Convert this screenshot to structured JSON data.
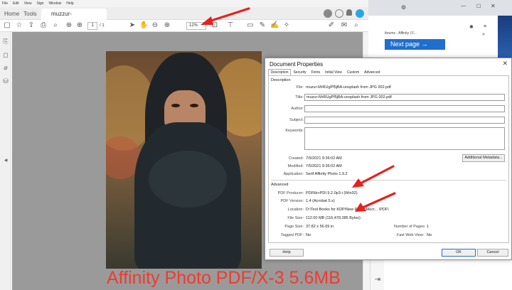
{
  "acrobat": {
    "menu": [
      "File",
      "Edit",
      "View",
      "Sign",
      "Window",
      "Help"
    ],
    "tabs": {
      "home": "Home",
      "tools": "Tools",
      "document": "muzzur-MrRUgPf5jk..."
    },
    "toolbar": {
      "page_current": "1",
      "page_total": "/ 1",
      "zoom": "12%"
    }
  },
  "caption": "Affinity Photo  PDF/X-3  5.6MB",
  "browser": {
    "url_fragment": "ibrums - Affinity | F...",
    "next_page": "Next page →"
  },
  "dialog": {
    "title": "Document Properties",
    "tabs": [
      "Description",
      "Security",
      "Fonts",
      "Initial View",
      "Custom",
      "Advanced"
    ],
    "description_section": "Description",
    "labels": {
      "file": "File:",
      "title": "Title:",
      "author": "Author:",
      "subject": "Subject:",
      "keywords": "Keywords:",
      "created": "Created:",
      "modified": "Modified:",
      "application": "Application:",
      "pdf_producer": "PDF Producer:",
      "pdf_version": "PDF Version:",
      "location": "Location:",
      "file_size": "File Size:",
      "page_size": "Page Size:",
      "tagged_pdf": "Tagged PDF:",
      "num_pages": "Number of Pages:",
      "fast_web_view": "Fast Web View:"
    },
    "values": {
      "file": "muzur-MrRUgPf5jBA-unsplash from JPG 002.pdf",
      "title": "muzur-MrRUgPf5jBA-unsplash from JPG 002.pdf",
      "author": "",
      "subject": "",
      "keywords": "",
      "created": "7/5/2021 9:36:02 AM",
      "modified": "7/5/2021 9:36:02 AM",
      "application": "Serif Affinity Photo 1.9.2",
      "pdf_producer": "PDFlib+PDI 9.2.0p3-i (Win32)",
      "pdf_version": "1.4 (Acrobat 5.x)",
      "location": "D:\\Test Books for KDP\\New Photo\\Mecr... \\PDF\\",
      "file_size": "112.00 MB (116,478,385 Bytes)",
      "page_size": "37.82 x 56.69 in",
      "tagged_pdf": "No",
      "num_pages": "1",
      "fast_web_view": "No"
    },
    "advanced_section": "Advanced",
    "additional_metadata": "Additional Metadata...",
    "help": "Help",
    "ok": "OK",
    "cancel": "Cancel"
  },
  "colors": {
    "annotation_red": "#e8211e",
    "caption_red": "#ef3b2f",
    "next_page_blue": "#1f6fcf"
  }
}
